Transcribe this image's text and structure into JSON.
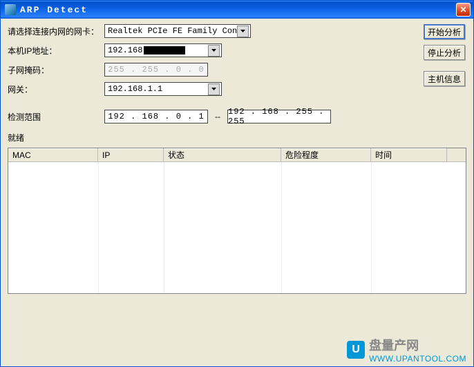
{
  "window": {
    "title": "ARP Detect"
  },
  "form": {
    "nic_label": "请选择连接内网的网卡：",
    "nic_value": "Realtek PCIe FE Family Controlle",
    "ip_label": "本机IP地址：",
    "ip_value": "192.168",
    "mask_label": "子网掩码：",
    "mask_value": "255 . 255 .   0  .   0",
    "gateway_label": "网关：",
    "gateway_value": "192.168.1.1"
  },
  "range": {
    "label": "检测范围",
    "start": "192 . 168 .   0  .   1",
    "end": "192 . 168 . 255 . 255",
    "sep": "--"
  },
  "buttons": {
    "start": "开始分析",
    "stop": "停止分析",
    "hostinfo": "主机信息",
    "close": "关闭"
  },
  "status": "就绪",
  "table": {
    "columns": [
      "MAC",
      "IP",
      "状态",
      "危险程度",
      "时间"
    ],
    "widths": [
      130,
      95,
      170,
      130,
      110
    ],
    "rows": []
  },
  "watermark": {
    "name": "盘量产网",
    "url": "WWW.UPANTOOL.COM"
  }
}
